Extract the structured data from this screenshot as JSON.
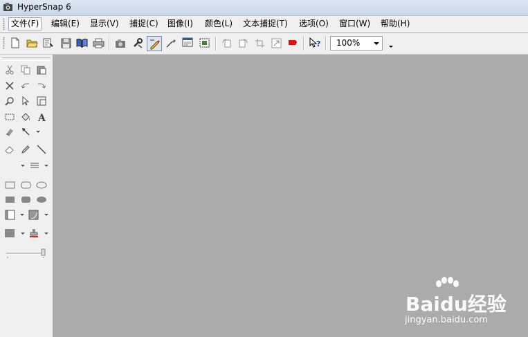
{
  "window": {
    "title": "HyperSnap 6"
  },
  "menu": {
    "items": [
      {
        "label": "文件(F)",
        "selected": true
      },
      {
        "label": "编辑(E)"
      },
      {
        "label": "显示(V)"
      },
      {
        "label": "捕捉(C)"
      },
      {
        "label": "图像(I)"
      },
      {
        "label": "颜色(L)"
      },
      {
        "label": "文本捕捉(T)"
      },
      {
        "label": "选项(O)"
      },
      {
        "label": "窗口(W)"
      },
      {
        "label": "帮助(H)"
      }
    ]
  },
  "toolbar": {
    "zoom_value": "100%",
    "icons": [
      "new-icon",
      "open-icon",
      "scan-icon",
      "save-icon",
      "book-icon",
      "print-icon",
      "camera-icon",
      "tools-icon",
      "capture-icon",
      "eyedropper-icon",
      "screenshot-icon",
      "region-icon",
      "rotate-left-icon",
      "rotate-right-icon",
      "crop-icon",
      "resize-icon",
      "stamp-icon",
      "help-icon"
    ]
  },
  "watermark": {
    "brand": "Baidu经验",
    "url": "jingyan.baidu.com"
  },
  "colors": {
    "canvas": "#ababab",
    "panel": "#f0f0f0",
    "menu_border": "#9aa9bd"
  }
}
